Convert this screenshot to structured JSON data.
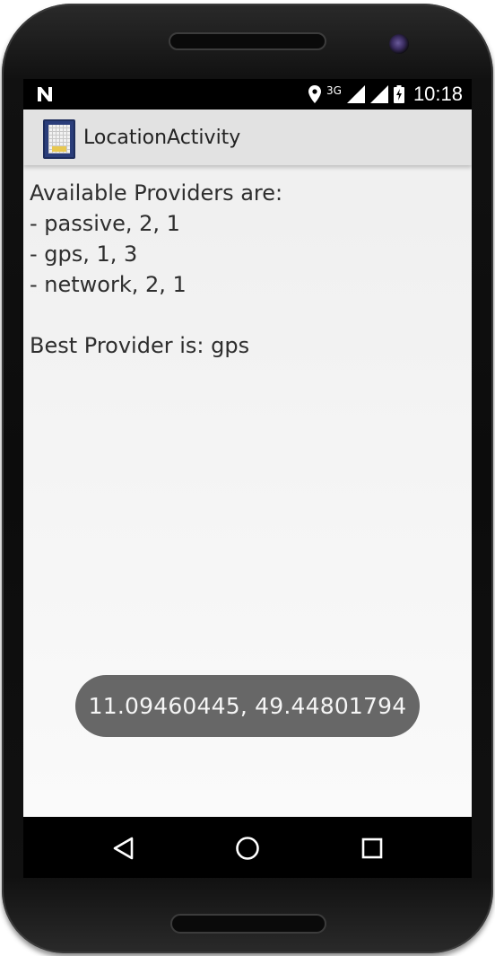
{
  "status_bar": {
    "time": "10:18",
    "network_type": "3G",
    "left_icon": "n-notification-icon",
    "icons": [
      "location-pin-icon",
      "signal-icon",
      "signal-icon",
      "battery-charging-icon"
    ]
  },
  "action_bar": {
    "title": "LocationActivity",
    "icon": "app-launcher-icon"
  },
  "content": {
    "heading": "Available Providers are:",
    "providers": [
      "- passive, 2, 1",
      "- gps, 1, 3",
      "- network, 2, 1"
    ],
    "best_provider": "Best Provider is: gps"
  },
  "toast": {
    "text": "11.09460445, 49.44801794"
  },
  "nav_bar": {
    "buttons": [
      "back-icon",
      "home-icon",
      "recents-icon"
    ]
  },
  "colors": {
    "toast_bg": "#676767",
    "action_bar_bg": "#e2e2e2",
    "status_bar_bg": "#000000",
    "device_body": "#111111"
  }
}
